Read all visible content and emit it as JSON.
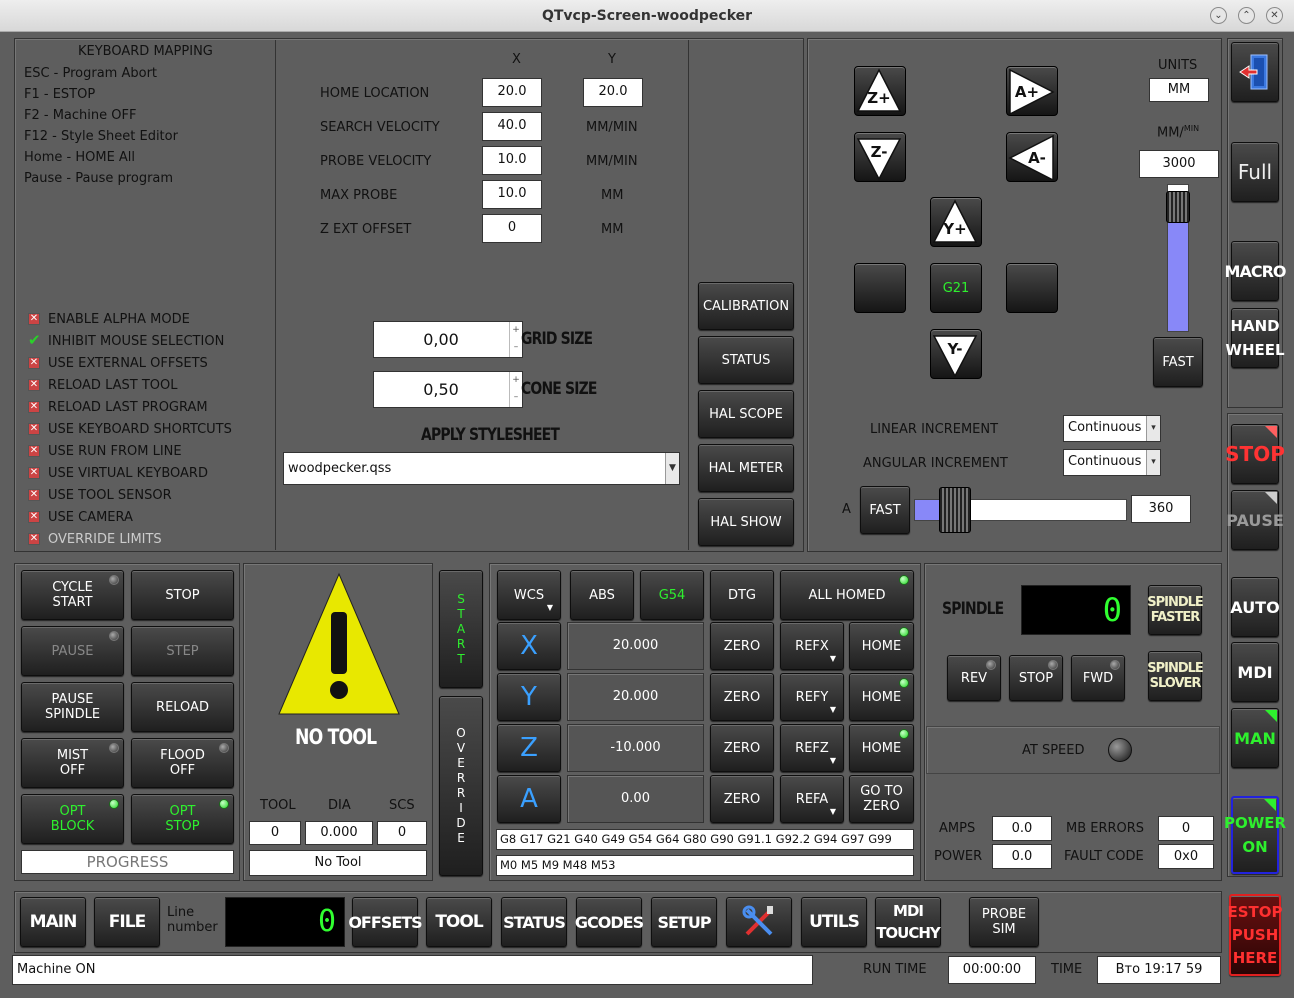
{
  "window": {
    "title": "QTvcp-Screen-woodpecker"
  },
  "keyboard": {
    "title": "KEYBOARD MAPPING",
    "lines": [
      "ESC - Program Abort",
      "F1 - ESTOP",
      "F2 - Machine OFF",
      "F12 - Style Sheet Editor",
      "Home - HOME All",
      "Pause - Pause program"
    ]
  },
  "options": [
    {
      "label": "ENABLE ALPHA MODE",
      "checked": false
    },
    {
      "label": "INHIBIT MOUSE SELECTION",
      "checked": true
    },
    {
      "label": "USE EXTERNAL OFFSETS",
      "checked": false
    },
    {
      "label": "RELOAD LAST TOOL",
      "checked": false
    },
    {
      "label": "RELOAD LAST PROGRAM",
      "checked": false
    },
    {
      "label": "USE KEYBOARD SHORTCUTS",
      "checked": false
    },
    {
      "label": "USE RUN FROM LINE",
      "checked": false
    },
    {
      "label": "USE VIRTUAL KEYBOARD",
      "checked": false
    },
    {
      "label": "USE TOOL SENSOR",
      "checked": false
    },
    {
      "label": "USE CAMERA",
      "checked": false
    },
    {
      "label": "OVERRIDE LIMITS",
      "checked": false
    }
  ],
  "probe": {
    "col_x": "X",
    "col_y": "Y",
    "home_label": "HOME LOCATION",
    "home_x": "20.0",
    "home_y": "20.0",
    "search_label": "SEARCH VELOCITY",
    "search_val": "40.0",
    "search_unit": "MM/MIN",
    "probevel_label": "PROBE VELOCITY",
    "probevel_val": "10.0",
    "probevel_unit": "MM/MIN",
    "maxprobe_label": "MAX PROBE",
    "maxprobe_val": "10.0",
    "maxprobe_unit": "MM",
    "zext_label": "Z EXT OFFSET",
    "zext_val": "0",
    "zext_unit": "MM"
  },
  "grid": {
    "value": "0,00",
    "label": "GRID SIZE"
  },
  "cone": {
    "value": "0,50",
    "label": "CONE SIZE"
  },
  "stylesheet": {
    "label": "APPLY STYLESHEET",
    "value": "woodpecker.qss"
  },
  "utils_buttons": [
    "CALIBRATION",
    "STATUS",
    "HAL SCOPE",
    "HAL METER",
    "HAL SHOW"
  ],
  "jog": {
    "units_label": "UNITS",
    "units_value": "MM",
    "rate_label": "MM/",
    "rate_sup": "MIN",
    "rate_value": "3000",
    "rate_level": 0.85,
    "fast": "FAST",
    "g21": "G21",
    "zplus": "Z+",
    "zminus": "Z-",
    "aplus": "A+",
    "aminus": "A-",
    "yplus": "Y+",
    "yminus": "Y-",
    "linear_label": "LINEAR INCREMENT",
    "linear_value": "Continuous",
    "angular_label": "ANGULAR INCREMENT",
    "angular_value": "Continuous",
    "a_label": "A",
    "a_fast": "FAST",
    "a_value": "360",
    "a_level": 0.12
  },
  "right_bar": {
    "exit_icon": "exit-door-icon",
    "full": "Full",
    "macro": "MACRO",
    "hand1": "HAND",
    "hand2": "WHEEL",
    "stop": "STOP",
    "pause": "PAUSE",
    "auto": "AUTO",
    "mdi": "MDI",
    "man": "MAN",
    "power1": "POWER",
    "power2": "ON",
    "estop1": "ESTOP",
    "estop2": "PUSH",
    "estop3": "HERE"
  },
  "cycle": {
    "cycle_start": "CYCLE\nSTART",
    "stop": "STOP",
    "pause": "PAUSE",
    "step": "STEP",
    "pause_spindle": "PAUSE\nSPINDLE",
    "reload": "RELOAD",
    "mist": "MIST\nOFF",
    "flood": "FLOOD\nOFF",
    "opt_block": "OPT\nBLOCK",
    "opt_stop": "OPT\nSTOP",
    "progress": "PROGRESS"
  },
  "tool": {
    "warning_icon": "warning-icon",
    "title": "NO TOOL",
    "col_tool": "TOOL",
    "col_dia": "DIA",
    "col_scs": "SCS",
    "tool": "0",
    "dia": "0.000",
    "scs": "0",
    "desc": "No Tool"
  },
  "vert": {
    "start": "START",
    "override": "OVERRIDE"
  },
  "dro": {
    "wcs": "WCS",
    "abs": "ABS",
    "g54": "G54",
    "dtg": "DTG",
    "homed": "ALL HOMED",
    "axes": [
      {
        "name": "X",
        "value": "20.000",
        "zero": "ZERO",
        "ref": "REFX",
        "home": "HOME"
      },
      {
        "name": "Y",
        "value": "20.000",
        "zero": "ZERO",
        "ref": "REFY",
        "home": "HOME"
      },
      {
        "name": "Z",
        "value": "-10.000",
        "zero": "ZERO",
        "ref": "REFZ",
        "home": "HOME"
      },
      {
        "name": "A",
        "value": "0.00",
        "zero": "ZERO",
        "ref": "REFA",
        "home": "GO TO\nZERO"
      }
    ],
    "gcodes": "G8 G17 G21 G40 G49 G54 G64 G80 G90 G91.1 G92.2 G94 G97 G99",
    "mcodes": "M0 M5 M9 M48 M53"
  },
  "spindle": {
    "label": "SPINDLE",
    "speed": "0",
    "faster": "SPINDLE\nFASTER",
    "slower": "SPINDLE\nSLOVER",
    "rev": "REV",
    "stop": "STOP",
    "fwd": "FWD",
    "at_speed": "AT SPEED",
    "amps_label": "AMPS",
    "amps": "0.0",
    "power_label": "POWER",
    "power": "0.0",
    "mb_label": "MB ERRORS",
    "mb": "0",
    "fault_label": "FAULT CODE",
    "fault": "0x0"
  },
  "bottom": {
    "main": "MAIN",
    "file": "FILE",
    "line_label": "Line\nnumber",
    "line": "0",
    "offsets": "OFFSETS",
    "tool": "TOOL",
    "status": "STATUS",
    "gcodes": "GCODES",
    "setup": "SETUP",
    "tools_icon": "screwdriver-wrench-icon",
    "utils": "UTILS",
    "mdi_touchy": "MDI\nTOUCHY",
    "probe_sim": "PROBE\nSIM"
  },
  "statusbar": {
    "message": "Machine ON",
    "run_label": "RUN TIME",
    "run_value": "00:00:00",
    "time_label": "TIME",
    "time_value": "Вто 19:17 59"
  }
}
